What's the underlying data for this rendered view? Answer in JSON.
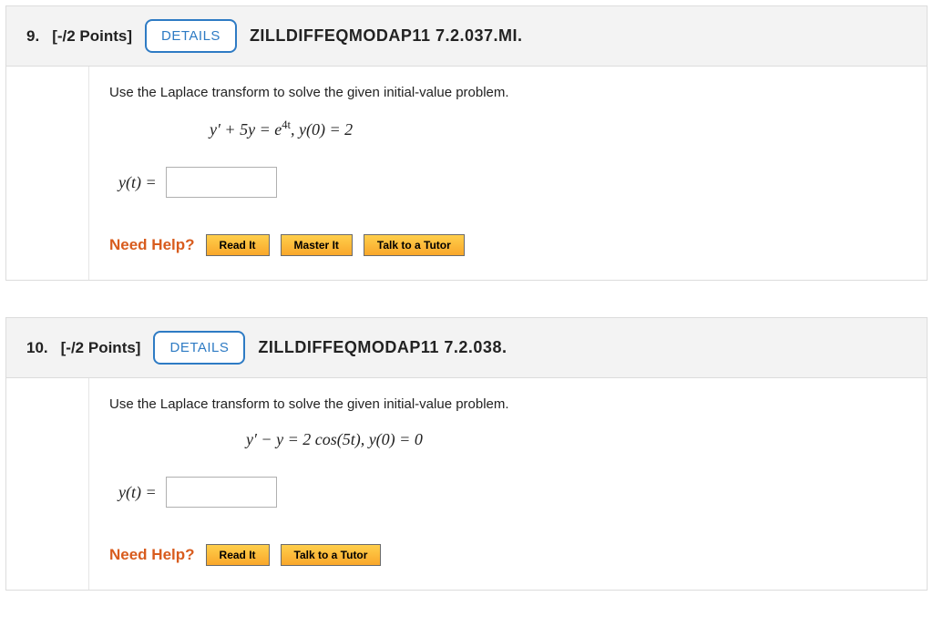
{
  "questions": [
    {
      "number": "9.",
      "points": "[-/2 Points]",
      "details": "DETAILS",
      "source": "ZILLDIFFEQMODAP11 7.2.037.MI.",
      "prompt": "Use the Laplace transform to solve the given initial-value problem.",
      "eq_lhs": "y′ + 5y = e",
      "eq_sup": "4t",
      "eq_rhs": ",  y(0) = 2",
      "yt": "y(t) =",
      "need_help": "Need Help?",
      "buttons": [
        {
          "label": "Read It"
        },
        {
          "label": "Master It"
        },
        {
          "label": "Talk to a Tutor"
        }
      ]
    },
    {
      "number": "10.",
      "points": "[-/2 Points]",
      "details": "DETAILS",
      "source": "ZILLDIFFEQMODAP11 7.2.038.",
      "prompt": "Use the Laplace transform to solve the given initial-value problem.",
      "eq_full": "y′ − y = 2 cos(5t),  y(0) = 0",
      "yt": "y(t) =",
      "need_help": "Need Help?",
      "buttons": [
        {
          "label": "Read It"
        },
        {
          "label": "Talk to a Tutor"
        }
      ]
    }
  ]
}
